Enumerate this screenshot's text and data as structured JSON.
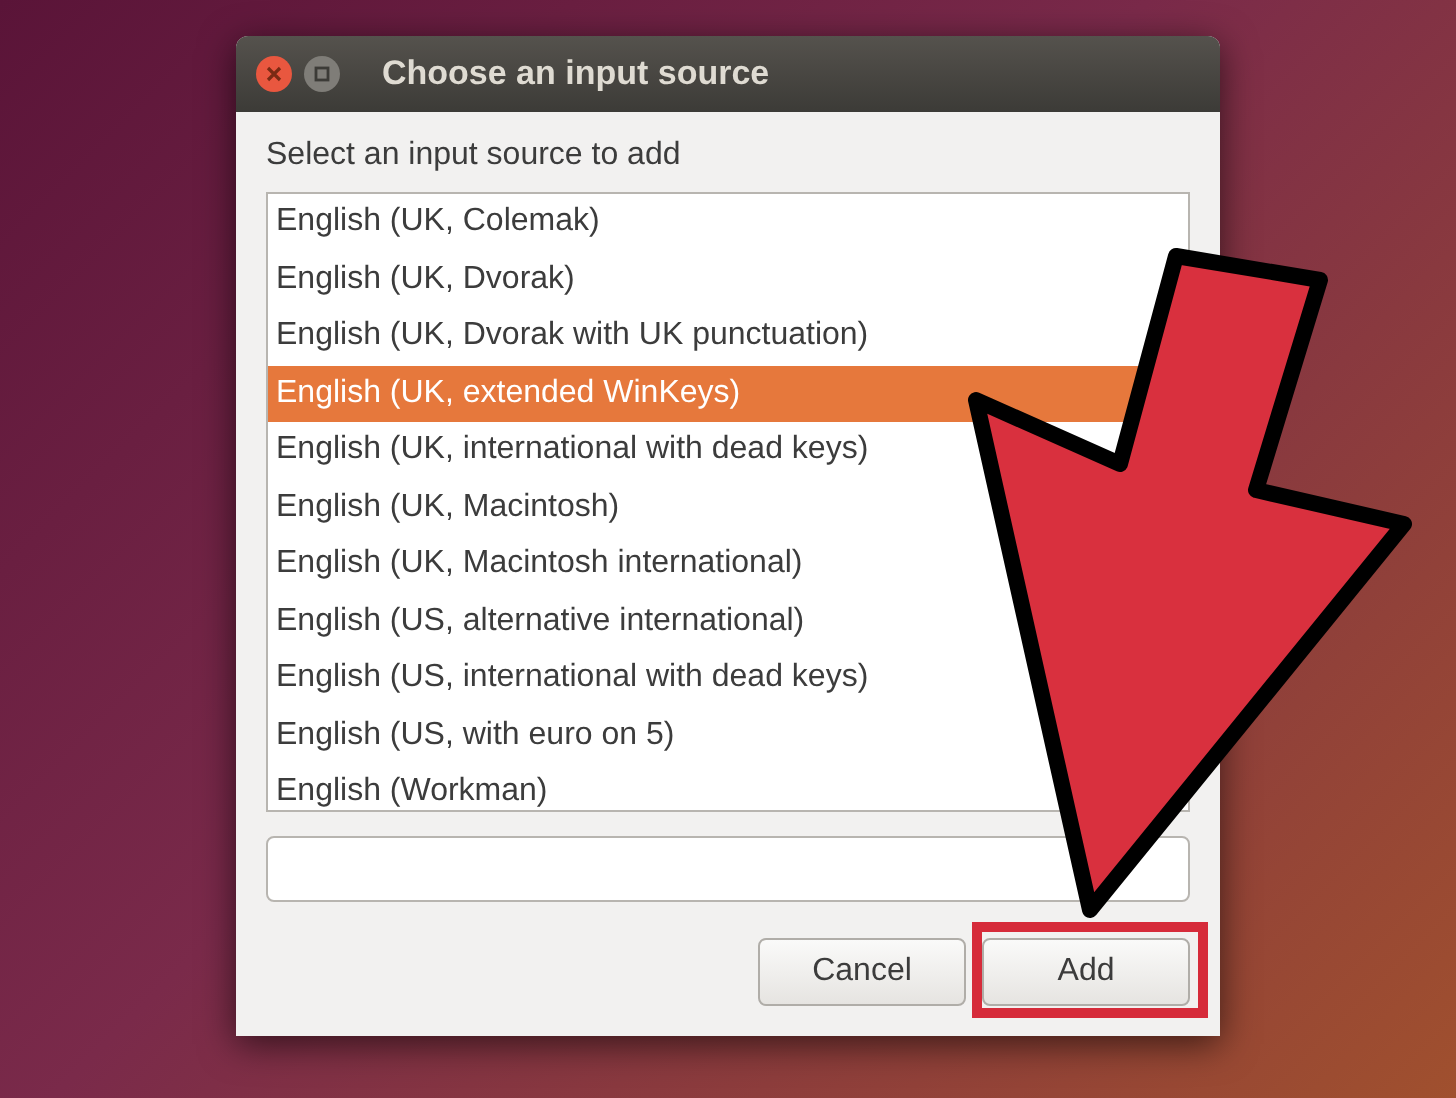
{
  "dialog": {
    "title": "Choose an input source",
    "prompt": "Select an input source to add",
    "sources": [
      {
        "label": "English (UK, Colemak)",
        "selected": false
      },
      {
        "label": "English (UK, Dvorak)",
        "selected": false
      },
      {
        "label": "English (UK, Dvorak with UK punctuation)",
        "selected": false
      },
      {
        "label": "English (UK, extended WinKeys)",
        "selected": true
      },
      {
        "label": "English (UK, international with dead keys)",
        "selected": false
      },
      {
        "label": "English (UK, Macintosh)",
        "selected": false
      },
      {
        "label": "English (UK, Macintosh international)",
        "selected": false
      },
      {
        "label": "English (US, alternative international)",
        "selected": false
      },
      {
        "label": "English (US, international with dead keys)",
        "selected": false
      },
      {
        "label": "English (US, with euro on 5)",
        "selected": false
      },
      {
        "label": "English (Workman)",
        "selected": false
      }
    ],
    "buttons": [
      "Cancel",
      "Add"
    ]
  }
}
